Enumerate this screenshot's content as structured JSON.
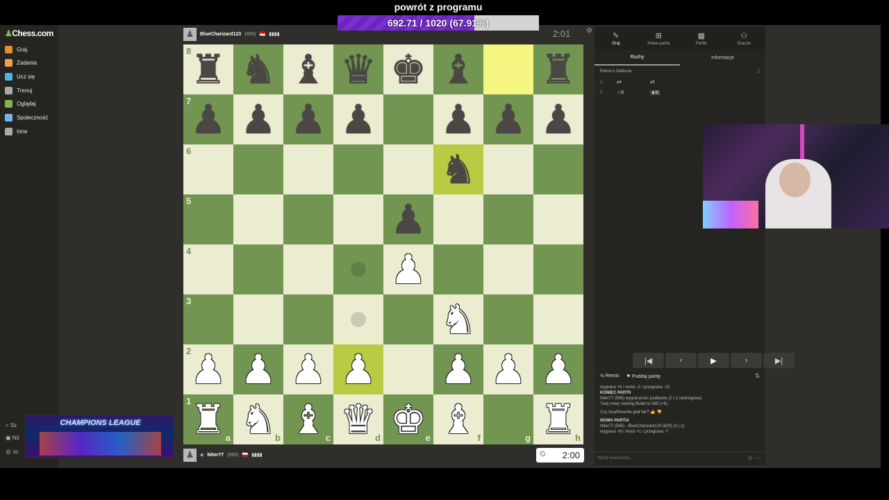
{
  "overlay": {
    "title": "powrót z programu",
    "progress_text": "692.71 / 1020 (67.91%)",
    "progress": 0.6791
  },
  "nav": {
    "logo_pawn": "♟",
    "logo_text": "Chess.com",
    "items": [
      {
        "label": "Graj",
        "icon": "play-icon",
        "color": "#e58f2a"
      },
      {
        "label": "Zadania",
        "icon": "puzzle-icon",
        "color": "#f1a24a"
      },
      {
        "label": "Ucz się",
        "icon": "learn-icon",
        "color": "#4fb3e8"
      },
      {
        "label": "Trenuj",
        "icon": "train-icon",
        "color": "#a9a9a9"
      },
      {
        "label": "Oglądaj",
        "icon": "watch-icon",
        "color": "#81b64c"
      },
      {
        "label": "Społeczność",
        "icon": "community-icon",
        "color": "#7ab4e6"
      },
      {
        "label": "Inne",
        "icon": "more-icon",
        "color": "#aaaaaa"
      }
    ],
    "search": "Sz",
    "user": "Nit"
  },
  "top_player": {
    "name": "BlueCharizard123",
    "rating": "(600)",
    "flag": "🇮🇩",
    "time": "2:01"
  },
  "bottom_player": {
    "name": "Niter77",
    "rating": "(565)",
    "flag": "🇵🇱",
    "time": "2:00"
  },
  "board": {
    "position": [
      [
        "r",
        "n",
        "b",
        "q",
        "k",
        "b",
        "",
        "r"
      ],
      [
        "p",
        "p",
        "p",
        "p",
        "",
        "p",
        "p",
        "p"
      ],
      [
        "",
        "",
        "",
        "",
        "",
        "n",
        "",
        ""
      ],
      [
        "",
        "",
        "",
        "",
        "p",
        "",
        "",
        ""
      ],
      [
        "",
        "",
        "",
        "",
        "P",
        "",
        "",
        ""
      ],
      [
        "",
        "",
        "",
        "",
        "",
        "N",
        "",
        ""
      ],
      [
        "P",
        "P",
        "P",
        "P",
        "",
        "P",
        "P",
        "P"
      ],
      [
        "R",
        "N",
        "B",
        "Q",
        "K",
        "B",
        "",
        "R"
      ]
    ],
    "highlights": [
      [
        0,
        6
      ],
      [
        2,
        5
      ],
      [
        6,
        3
      ]
    ],
    "dots": [
      [
        4,
        3
      ],
      [
        5,
        3
      ]
    ],
    "ranks": [
      "8",
      "7",
      "6",
      "5",
      "4",
      "3",
      "2",
      "1"
    ],
    "files": [
      "a",
      "b",
      "c",
      "d",
      "e",
      "f",
      "g",
      "h"
    ]
  },
  "panel": {
    "top_tabs": [
      {
        "label": "Graj",
        "icon": "play-icon",
        "glyph": "✎"
      },
      {
        "label": "Nowa partia",
        "icon": "new-game-icon",
        "glyph": "⊞"
      },
      {
        "label": "Partie",
        "icon": "games-icon",
        "glyph": "▦"
      },
      {
        "label": "Gracze",
        "icon": "players-icon",
        "glyph": "⚇"
      }
    ],
    "sub_tabs": [
      "Ruchy",
      "Informacje"
    ],
    "opening": "Petrov's Defense",
    "moves": [
      {
        "n": "1.",
        "w": "e4",
        "b": "e5"
      },
      {
        "n": "2.",
        "w": "♘f3",
        "b": "♞f6"
      }
    ],
    "actions": {
      "draw": "½ Remis",
      "resign": "⚑ Poddaj partię"
    },
    "chat": {
      "line1": "wygrana +6 / remis -2 / przegrana -10",
      "end_header": "KONIEC PARTII",
      "end_line1": "Niter77 (565) wygrał przez poddanie (2 | 1 rankingowa)",
      "end_line2": "Twój nowy ranking Bullet to 565 (+6).",
      "fair_q": "Czy IncaRoserite grał fair?",
      "new_header": "NOWA PARTIA",
      "new_line1": "Niter77 (565) - BlueCharizard123 (600) (2 | 1)",
      "new_line2": "wygrana +9 / remis +1 / przegrana -7",
      "placeholder": "Wyślij wiadomość..."
    }
  },
  "promo": {
    "text": "CHAMPIONS LEAGUE"
  }
}
